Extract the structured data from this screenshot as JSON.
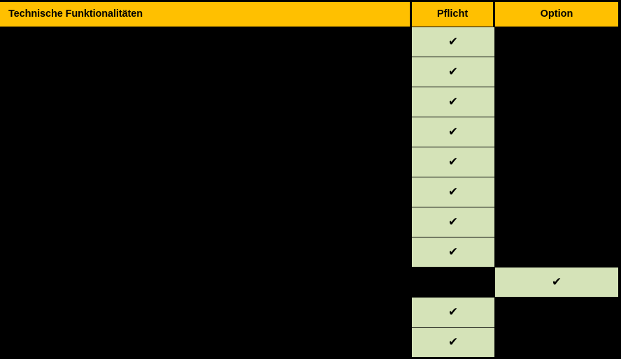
{
  "table": {
    "columns": [
      {
        "key": "feature",
        "label": "Technische Funktionalitäten",
        "align": "left"
      },
      {
        "key": "pflicht",
        "label": "Pflicht",
        "align": "center"
      },
      {
        "key": "option",
        "label": "Option",
        "align": "center"
      }
    ],
    "header_background": "#ffc000",
    "header_text_color": "#000000",
    "cell_marked_background": "#d5e3b8",
    "cell_unmarked_background": "#000000",
    "body_background": "#000000",
    "check_glyph": "✔",
    "rows": [
      {
        "feature": "",
        "pflicht": true,
        "option": false
      },
      {
        "feature": "",
        "pflicht": true,
        "option": false
      },
      {
        "feature": "",
        "pflicht": true,
        "option": false
      },
      {
        "feature": "",
        "pflicht": true,
        "option": false
      },
      {
        "feature": "",
        "pflicht": true,
        "option": false
      },
      {
        "feature": "",
        "pflicht": true,
        "option": false
      },
      {
        "feature": "",
        "pflicht": true,
        "option": false
      },
      {
        "feature": "",
        "pflicht": true,
        "option": false
      },
      {
        "feature": "",
        "pflicht": false,
        "option": true
      },
      {
        "feature": "",
        "pflicht": true,
        "option": false
      },
      {
        "feature": "",
        "pflicht": true,
        "option": false
      }
    ]
  }
}
